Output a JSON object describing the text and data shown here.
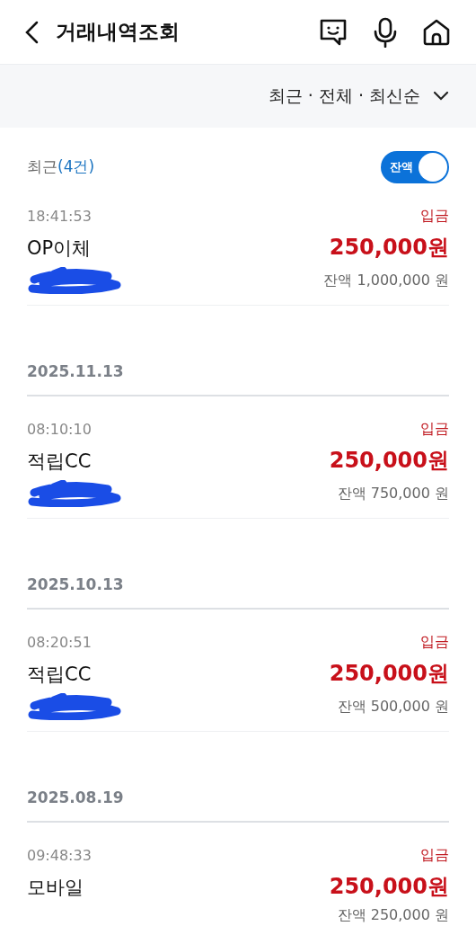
{
  "header": {
    "title": "거래내역조회"
  },
  "filter": {
    "label": "최근 · 전체 · 최신순"
  },
  "summary": {
    "label": "최근",
    "count": "(4건)"
  },
  "balance_toggle": {
    "label": "잔액",
    "on": true
  },
  "recent": [
    {
      "time": "18:41:53",
      "type": "입금",
      "name": "OP이체",
      "amount": "250,000원",
      "balance": "잔액 1,000,000 원",
      "redacted": true
    }
  ],
  "date_groups": [
    {
      "date": "2025.11.13",
      "transactions": [
        {
          "time": "08:10:10",
          "type": "입금",
          "name": "적립CC",
          "amount": "250,000원",
          "balance": "잔액 750,000 원",
          "redacted": true
        }
      ]
    },
    {
      "date": "2025.10.13",
      "transactions": [
        {
          "time": "08:20:51",
          "type": "입금",
          "name": "적립CC",
          "amount": "250,000원",
          "balance": "잔액 500,000 원",
          "redacted": true
        }
      ]
    },
    {
      "date": "2025.08.19",
      "transactions": [
        {
          "time": "09:48:33",
          "type": "입금",
          "name": "모바일",
          "amount": "250,000원",
          "balance": "잔액 250,000 원",
          "redacted": false
        }
      ]
    }
  ]
}
